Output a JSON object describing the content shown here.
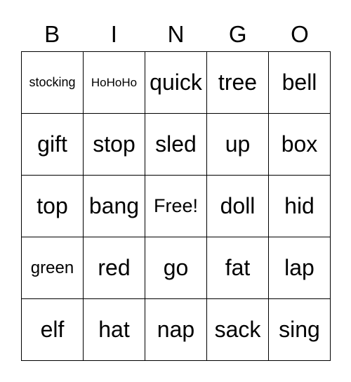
{
  "header": [
    "B",
    "I",
    "N",
    "G",
    "O"
  ],
  "cells": [
    [
      "stocking",
      "HoHoHo",
      "quick",
      "tree",
      "bell"
    ],
    [
      "gift",
      "stop",
      "sled",
      "up",
      "box"
    ],
    [
      "top",
      "bang",
      "Free!",
      "doll",
      "hid"
    ],
    [
      "green",
      "red",
      "go",
      "fat",
      "lap"
    ],
    [
      "elf",
      "hat",
      "nap",
      "sack",
      "sing"
    ]
  ]
}
